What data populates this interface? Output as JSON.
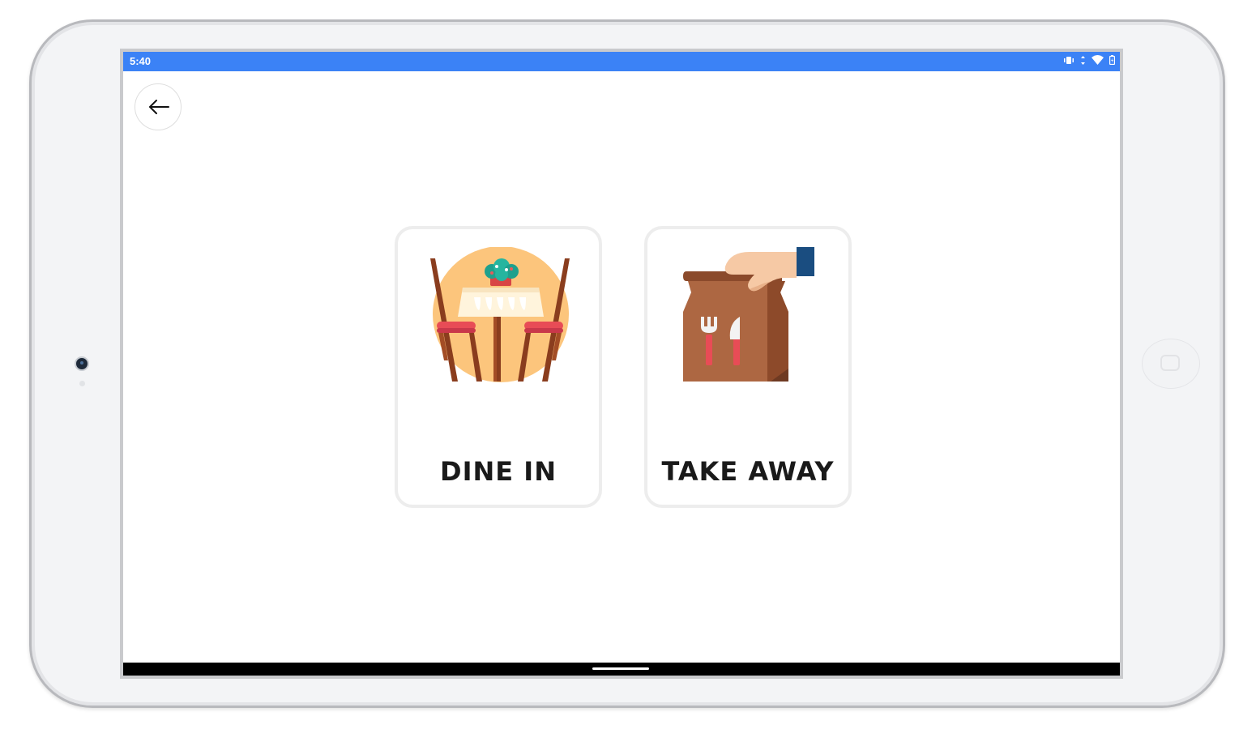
{
  "device": {
    "camera_icon": "camera-icon",
    "home_icon": "home-button-icon"
  },
  "statusbar": {
    "time": "5:40",
    "background": "#3b82f6",
    "icons": [
      "vibrate-icon",
      "data-arrows-icon",
      "wifi-icon",
      "battery-icon"
    ]
  },
  "header": {
    "back_icon": "arrow-left-icon"
  },
  "options": [
    {
      "label": "DINE IN",
      "icon": "restaurant-table-icon"
    },
    {
      "label": "TAKE AWAY",
      "icon": "takeaway-bag-icon"
    }
  ],
  "navbar": {
    "handle_icon": "gesture-handle-icon"
  }
}
